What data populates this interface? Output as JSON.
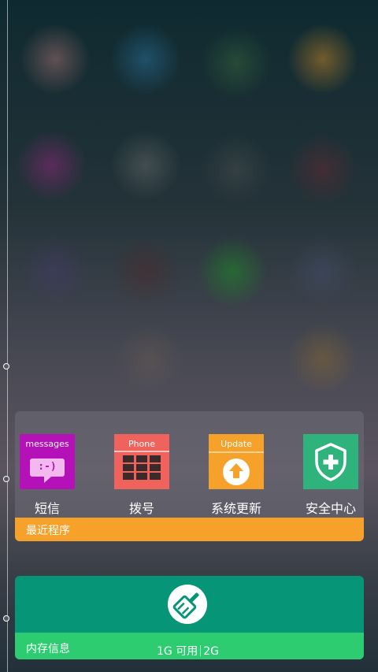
{
  "recent_apps": {
    "title": "最近程序",
    "items": [
      {
        "name": "短信",
        "tile_label": "messages",
        "tile_color": "#b412b8",
        "icon": "message-icon",
        "icon_text": ":-)"
      },
      {
        "name": "拨号",
        "tile_label": "Phone",
        "tile_color": "#f0625c",
        "icon": "dialpad-icon"
      },
      {
        "name": "系统更新",
        "tile_label": "Update",
        "tile_color": "#f6a12a",
        "icon": "update-arrow-icon"
      },
      {
        "name": "安全中心",
        "tile_label": "",
        "tile_color": "#2fb37d",
        "icon": "shield-plus-icon"
      }
    ]
  },
  "memory": {
    "title": "内存信息",
    "available": "1G 可用",
    "total": "2G",
    "clean_icon": "broom-icon",
    "card_color": "#079577",
    "bar_color": "#2dcc70"
  },
  "accent": "#f6a12a"
}
